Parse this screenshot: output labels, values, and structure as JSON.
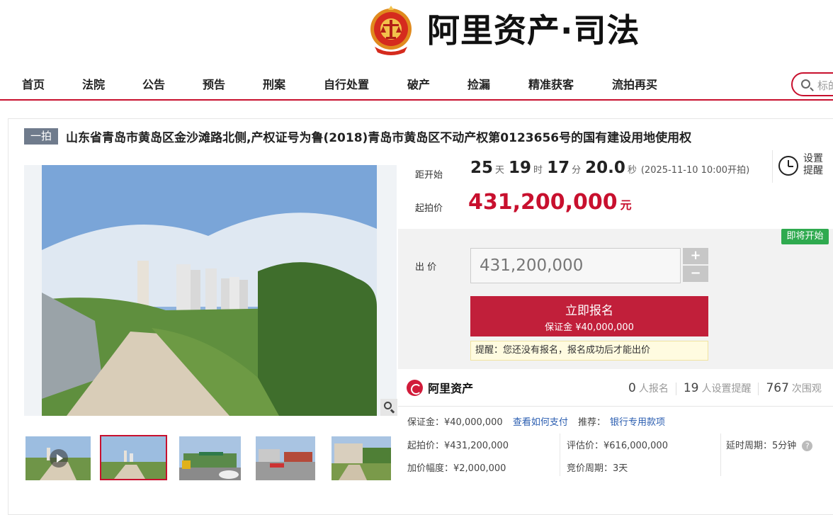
{
  "brand": {
    "name": "阿里资产·司法"
  },
  "nav": {
    "items": [
      "首页",
      "法院",
      "公告",
      "预告",
      "刑案",
      "自行处置",
      "破产",
      "捡漏",
      "精准获客",
      "流拍再买"
    ],
    "search_placeholder": "标的"
  },
  "lot": {
    "badge": "一拍",
    "title": "山东省青岛市黄岛区金沙滩路北侧,产权证号为鲁(2018)青岛市黄岛区不动产权第0123656号的国有建设用地使用权"
  },
  "countdown": {
    "label": "距开始",
    "days": "25",
    "days_unit": "天",
    "hours": "19",
    "hours_unit": "时",
    "minutes": "17",
    "minutes_unit": "分",
    "seconds": "20.0",
    "seconds_unit": "秒",
    "start_note": "(2025-11-10 10:00开拍)"
  },
  "reminder": {
    "label_1": "设置",
    "label_2": "提醒"
  },
  "start_price": {
    "label": "起拍价",
    "value": "431,200,000",
    "unit": "元"
  },
  "bid": {
    "status_tag": "即将开始",
    "label": "出 价",
    "value": "431,200,000",
    "plus": "+",
    "minus": "−",
    "signup_button": "立即报名",
    "deposit_note": "保证金 ¥40,000,000",
    "tip": "提醒：您还没有报名，报名成功后才能出价"
  },
  "stats": {
    "logo_text": "阿里资产",
    "registrations": "0",
    "registrations_label": "人报名",
    "reminders": "19",
    "reminders_label": "人设置提醒",
    "views": "767",
    "views_label": "次围观"
  },
  "details": {
    "deposit": "保证金：¥40,000,000",
    "how_to_pay": "查看如何支付",
    "recommend_label": "推荐：",
    "recommend_link": "银行专用款项",
    "start_price": "起拍价：¥431,200,000",
    "increment": "加价幅度：¥2,000,000",
    "appraisal": "评估价：¥616,000,000",
    "bidding_period": "竞价周期：3天",
    "delay_period": "延时周期：5分钟",
    "help": "?"
  },
  "colors": {
    "accent": "#c8102e",
    "button": "#c11f3a",
    "status_green": "#2faa4f",
    "link": "#2a5db0"
  },
  "icons": [
    "court-emblem-icon",
    "search-icon",
    "alarm-clock-icon",
    "zoom-icon",
    "play-icon",
    "ali-asset-logo-icon",
    "help-icon"
  ]
}
